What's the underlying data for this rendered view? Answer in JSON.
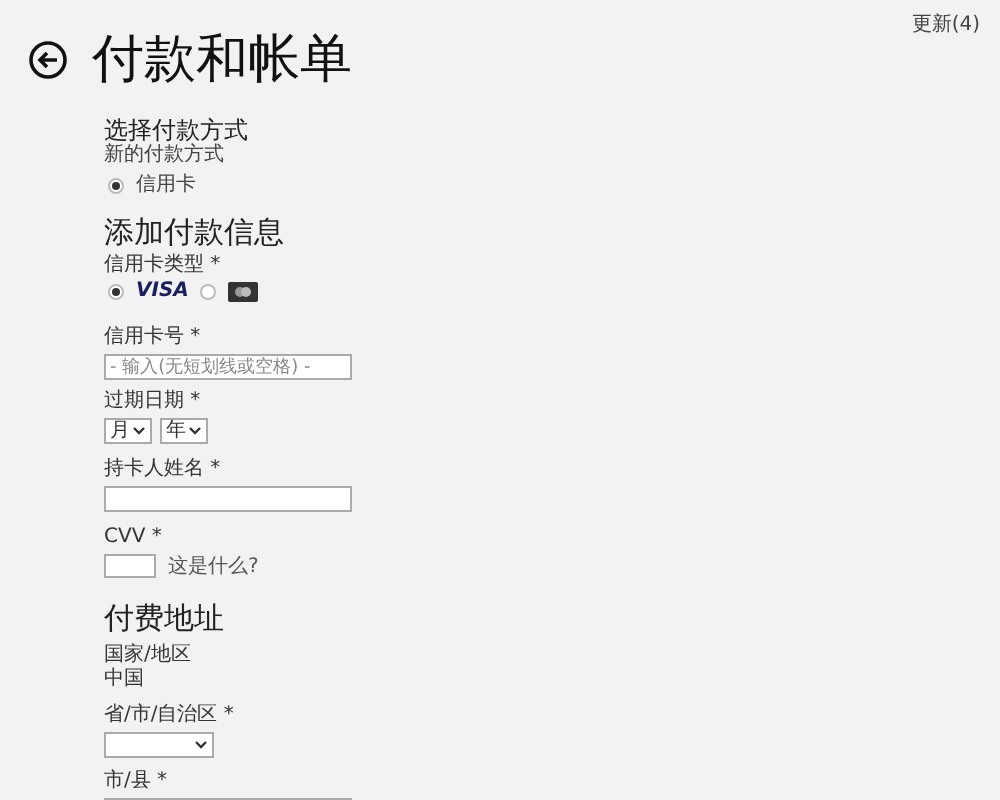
{
  "header": {
    "title": "付款和帐单",
    "update_link": "更新(4)"
  },
  "payment_method": {
    "heading": "选择付款方式",
    "subtitle": "新的付款方式",
    "options": [
      {
        "label": "信用卡",
        "selected": true
      }
    ]
  },
  "payment_info": {
    "heading": "添加付款信息",
    "card_type": {
      "label": "信用卡类型 *",
      "options": [
        {
          "kind": "visa",
          "label": "VISA",
          "selected": true
        },
        {
          "kind": "card-logo",
          "selected": false
        }
      ]
    },
    "card_number": {
      "label": "信用卡号 *",
      "placeholder": "- 输入(无短划线或空格) -"
    },
    "expiry": {
      "label": "过期日期 *",
      "month": "月",
      "year": "年"
    },
    "cardholder": {
      "label": "持卡人姓名 *"
    },
    "cvv": {
      "label": "CVV *",
      "help_link": "这是什么?"
    }
  },
  "billing_address": {
    "heading": "付费地址",
    "country_label": "国家/地区",
    "country": "中国",
    "province_label": "省/市/自治区 *",
    "city_label": "市/县 *"
  }
}
